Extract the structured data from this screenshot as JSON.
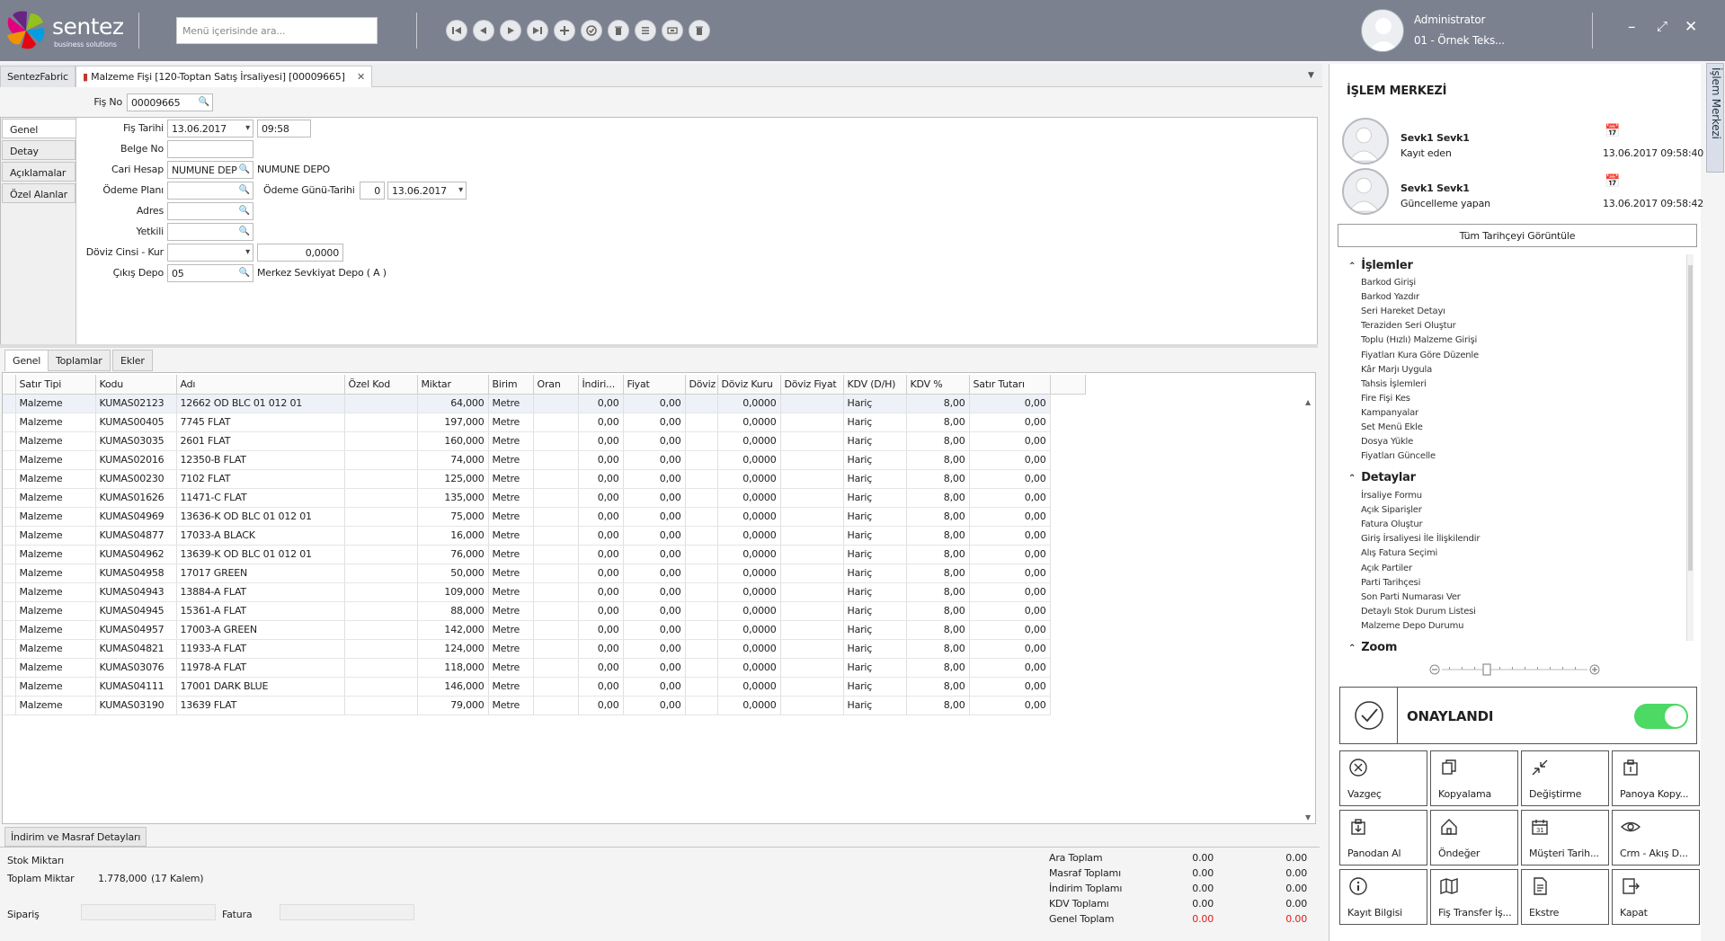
{
  "app": {
    "brand": "sentez",
    "brand_sub": "business solutions",
    "search_placeholder": "Menü içerisinde ara...",
    "user_name": "Administrator",
    "user_company": "01 - Örnek Teks..."
  },
  "tabs": [
    {
      "label": "SentezFabric"
    },
    {
      "label": "Malzeme Fişi [120-Toptan Satış İrsaliyesi]  [00009665]"
    }
  ],
  "form": {
    "fis_no_label": "Fiş No",
    "fis_no": "00009665",
    "fis_tarihi_label": "Fiş Tarihi",
    "fis_tarihi": "13.06.2017",
    "fis_saat": "09:58",
    "belge_no_label": "Belge No",
    "belge_no": "",
    "cari_hesap_label": "Cari Hesap",
    "cari_hesap": "NUMUNE DEP",
    "cari_hesap_name": "NUMUNE DEPO",
    "odeme_plani_label": "Ödeme Planı",
    "odeme_gunu_label": "Ödeme Günü-Tarihi",
    "odeme_gunu": "0",
    "odeme_tarihi": "13.06.2017",
    "adres_label": "Adres",
    "yetkili_label": "Yetkili",
    "doviz_label": "Döviz Cinsi - Kur",
    "doviz_kur": "0,0000",
    "cikis_depo_label": "Çıkış Depo",
    "cikis_depo": "05",
    "cikis_depo_name": "Merkez Sevkiyat Depo ( A )"
  },
  "side_tabs": [
    "Genel",
    "Detay",
    "Açıklamalar",
    "Özel Alanlar"
  ],
  "grid_tabs": [
    "Genel",
    "Toplamlar",
    "Ekler"
  ],
  "grid": {
    "columns": [
      "Satır Tipi",
      "Kodu",
      "Adı",
      "Özel Kod",
      "Miktar",
      "Birim",
      "Oran",
      "İndiri...",
      "Fiyat",
      "Döviz",
      "Döviz Kuru",
      "Döviz Fiyat",
      "KDV (D/H)",
      "KDV %",
      "Satır Tutarı"
    ],
    "rows": [
      [
        "Malzeme",
        "KUMAS02123",
        "12662 OD BLC 01 012 01",
        "",
        "64,000",
        "Metre",
        "",
        "0,00",
        "0,00",
        "",
        "0,0000",
        "",
        "Hariç",
        "8,00",
        "0,00"
      ],
      [
        "Malzeme",
        "KUMAS00405",
        "7745 FLAT",
        "",
        "197,000",
        "Metre",
        "",
        "0,00",
        "0,00",
        "",
        "0,0000",
        "",
        "Hariç",
        "8,00",
        "0,00"
      ],
      [
        "Malzeme",
        "KUMAS03035",
        "2601 FLAT",
        "",
        "160,000",
        "Metre",
        "",
        "0,00",
        "0,00",
        "",
        "0,0000",
        "",
        "Hariç",
        "8,00",
        "0,00"
      ],
      [
        "Malzeme",
        "KUMAS02016",
        "12350-B FLAT",
        "",
        "74,000",
        "Metre",
        "",
        "0,00",
        "0,00",
        "",
        "0,0000",
        "",
        "Hariç",
        "8,00",
        "0,00"
      ],
      [
        "Malzeme",
        "KUMAS00230",
        "7102 FLAT",
        "",
        "125,000",
        "Metre",
        "",
        "0,00",
        "0,00",
        "",
        "0,0000",
        "",
        "Hariç",
        "8,00",
        "0,00"
      ],
      [
        "Malzeme",
        "KUMAS01626",
        "11471-C FLAT",
        "",
        "135,000",
        "Metre",
        "",
        "0,00",
        "0,00",
        "",
        "0,0000",
        "",
        "Hariç",
        "8,00",
        "0,00"
      ],
      [
        "Malzeme",
        "KUMAS04969",
        "13636-K OD BLC 01 012 01",
        "",
        "75,000",
        "Metre",
        "",
        "0,00",
        "0,00",
        "",
        "0,0000",
        "",
        "Hariç",
        "8,00",
        "0,00"
      ],
      [
        "Malzeme",
        "KUMAS04877",
        "17033-A BLACK",
        "",
        "16,000",
        "Metre",
        "",
        "0,00",
        "0,00",
        "",
        "0,0000",
        "",
        "Hariç",
        "8,00",
        "0,00"
      ],
      [
        "Malzeme",
        "KUMAS04962",
        "13639-K OD BLC 01 012 01",
        "",
        "76,000",
        "Metre",
        "",
        "0,00",
        "0,00",
        "",
        "0,0000",
        "",
        "Hariç",
        "8,00",
        "0,00"
      ],
      [
        "Malzeme",
        "KUMAS04958",
        "17017 GREEN",
        "",
        "50,000",
        "Metre",
        "",
        "0,00",
        "0,00",
        "",
        "0,0000",
        "",
        "Hariç",
        "8,00",
        "0,00"
      ],
      [
        "Malzeme",
        "KUMAS04943",
        "13884-A FLAT",
        "",
        "109,000",
        "Metre",
        "",
        "0,00",
        "0,00",
        "",
        "0,0000",
        "",
        "Hariç",
        "8,00",
        "0,00"
      ],
      [
        "Malzeme",
        "KUMAS04945",
        "15361-A FLAT",
        "",
        "88,000",
        "Metre",
        "",
        "0,00",
        "0,00",
        "",
        "0,0000",
        "",
        "Hariç",
        "8,00",
        "0,00"
      ],
      [
        "Malzeme",
        "KUMAS04957",
        "17003-A GREEN",
        "",
        "142,000",
        "Metre",
        "",
        "0,00",
        "0,00",
        "",
        "0,0000",
        "",
        "Hariç",
        "8,00",
        "0,00"
      ],
      [
        "Malzeme",
        "KUMAS04821",
        "11933-A FLAT",
        "",
        "124,000",
        "Metre",
        "",
        "0,00",
        "0,00",
        "",
        "0,0000",
        "",
        "Hariç",
        "8,00",
        "0,00"
      ],
      [
        "Malzeme",
        "KUMAS03076",
        "11978-A FLAT",
        "",
        "118,000",
        "Metre",
        "",
        "0,00",
        "0,00",
        "",
        "0,0000",
        "",
        "Hariç",
        "8,00",
        "0,00"
      ],
      [
        "Malzeme",
        "KUMAS04111",
        "17001 DARK BLUE",
        "",
        "146,000",
        "Metre",
        "",
        "0,00",
        "0,00",
        "",
        "0,0000",
        "",
        "Hariç",
        "8,00",
        "0,00"
      ],
      [
        "Malzeme",
        "KUMAS03190",
        "13639 FLAT",
        "",
        "79,000",
        "Metre",
        "",
        "0,00",
        "0,00",
        "",
        "0,0000",
        "",
        "Hariç",
        "8,00",
        "0,00"
      ]
    ]
  },
  "bottom": {
    "tab_label": "İndirim ve Masraf Detayları",
    "stok_miktari_label": "Stok Miktarı",
    "toplam_miktar_label": "Toplam Miktar",
    "toplam_miktar": "1.778,000",
    "kalem": "(17 Kalem)",
    "siparis_label": "Sipariş",
    "fatura_label": "Fatura",
    "totals": [
      {
        "label": "Ara Toplam",
        "v1": "0.00",
        "v2": "0.00"
      },
      {
        "label": "Masraf Toplamı",
        "v1": "0.00",
        "v2": "0.00"
      },
      {
        "label": "İndirim Toplamı",
        "v1": "0.00",
        "v2": "0.00"
      },
      {
        "label": "KDV Toplamı",
        "v1": "0.00",
        "v2": "0.00"
      },
      {
        "label": "Genel Toplam",
        "v1": "0.00",
        "v2": "0.00"
      }
    ]
  },
  "panel": {
    "title": "İŞLEM MERKEZİ",
    "vertical_tab": "İşlem Merkezi",
    "created_name": "Sevk1 Sevk1",
    "created_role": "Kayıt eden",
    "created_date": "13.06.2017 09:58:40",
    "updated_name": "Sevk1 Sevk1",
    "updated_role": "Güncelleme yapan",
    "updated_date": "13.06.2017 09:58:42",
    "history_button": "Tüm Tarihçeyi Görüntüle",
    "islemler_title": "İşlemler",
    "islemler": [
      "Barkod Girişi",
      "Barkod Yazdır",
      "Seri Hareket Detayı",
      "Teraziden Seri Oluştur",
      "Toplu (Hızlı) Malzeme Girişi",
      "Fiyatları Kura Göre Düzenle",
      "Kâr Marjı Uygula",
      "Tahsis İşlemleri",
      "Fire Fişi Kes",
      "Kampanyalar",
      "Set Menü Ekle",
      "Dosya Yükle",
      "Fiyatları Güncelle"
    ],
    "detaylar_title": "Detaylar",
    "detaylar": [
      "İrsaliye Formu",
      "Açık Siparişler",
      "Fatura Oluştur",
      "Giriş İrsaliyesi İle İlişkilendir",
      "Alış Fatura Seçimi",
      "Açık Partiler",
      "Parti Tarihçesi",
      "Son Parti Numarası Ver",
      "Detaylı Stok Durum Listesi",
      "Malzeme Depo Durumu"
    ],
    "zoom_title": "Zoom",
    "status": "ONAYLANDI",
    "actions": [
      {
        "label": "Vazgeç",
        "icon": "cancel-icon"
      },
      {
        "label": "Kopyalama",
        "icon": "copy-icon"
      },
      {
        "label": "Değiştirme",
        "icon": "shrink-icon"
      },
      {
        "label": "Panoya Kopy...",
        "icon": "clipboard-copy-icon"
      },
      {
        "label": "Panodan Al",
        "icon": "clipboard-paste-icon"
      },
      {
        "label": "Öndeğer",
        "icon": "home-icon"
      },
      {
        "label": "Müşteri Tarih...",
        "icon": "calendar-icon"
      },
      {
        "label": "Crm - Akış D...",
        "icon": "eye-icon"
      },
      {
        "label": "Kayıt Bilgisi",
        "icon": "info-icon"
      },
      {
        "label": "Fiş Transfer İş...",
        "icon": "map-icon"
      },
      {
        "label": "Ekstre",
        "icon": "document-icon"
      },
      {
        "label": "Kapat",
        "icon": "exit-icon"
      }
    ]
  }
}
